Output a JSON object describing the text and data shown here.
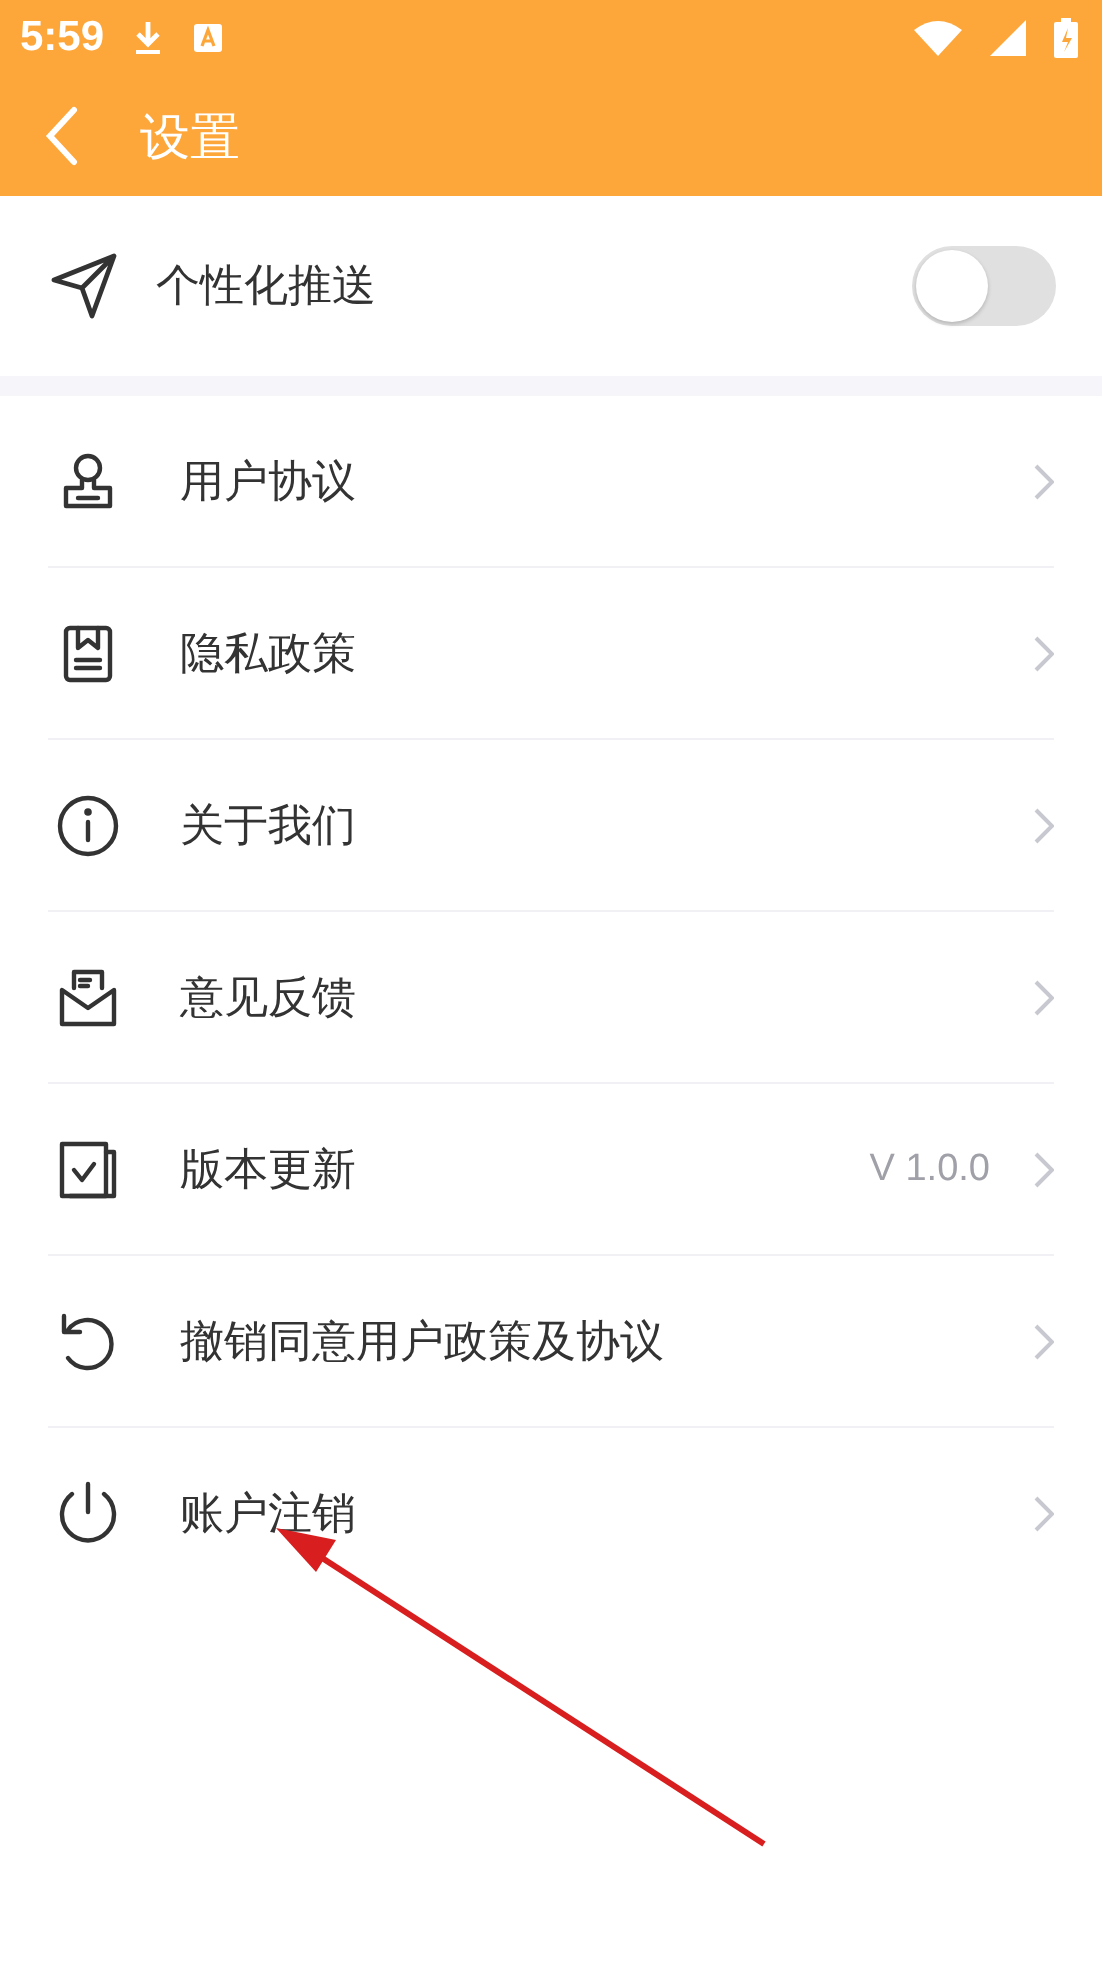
{
  "status_bar": {
    "time": "5:59"
  },
  "app_bar": {
    "title": "设置"
  },
  "push": {
    "label": "个性化推送",
    "on": false
  },
  "items": [
    {
      "label": "用户协议"
    },
    {
      "label": "隐私政策"
    },
    {
      "label": "关于我们"
    },
    {
      "label": "意见反馈"
    },
    {
      "label": "版本更新",
      "value": "V 1.0.0"
    },
    {
      "label": "撤销同意用户政策及协议"
    },
    {
      "label": "账户注销"
    }
  ]
}
